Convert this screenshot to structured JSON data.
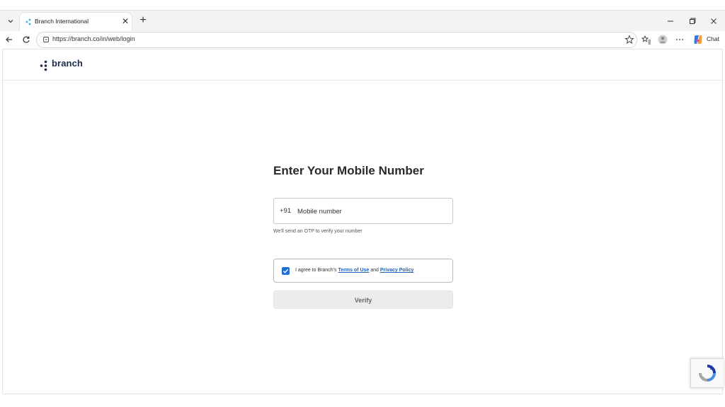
{
  "browser": {
    "tab": {
      "title": "Branch International"
    },
    "url": "https://branch.co/in/web/login",
    "chat_label": "Chat"
  },
  "site": {
    "logo_text": "branch"
  },
  "login": {
    "heading": "Enter Your Mobile Number",
    "country_code": "+91",
    "phone_placeholder": "Mobile number",
    "helper": "We'll send an OTP to verify your number",
    "consent": {
      "checked": true,
      "prefix": "I agree to Branch's ",
      "terms_label": "Terms of Use",
      "and": " and ",
      "privacy_label": "Privacy Policy"
    },
    "verify_label": "Verify"
  },
  "colors": {
    "accent": "#1e6fd9",
    "link": "#1d5fbf",
    "logo": "#1b2a4e",
    "button_disabled": "#ececec"
  }
}
